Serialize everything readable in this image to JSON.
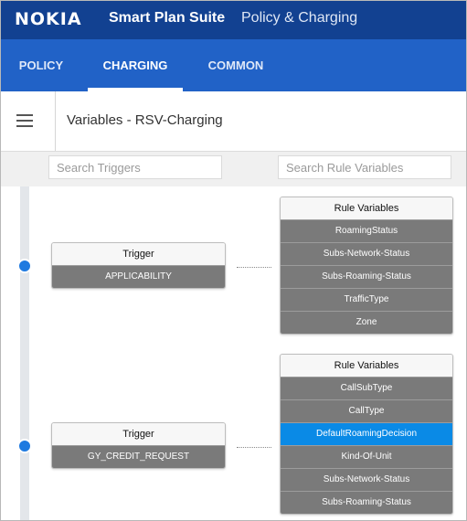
{
  "header": {
    "logo": "NOKIA",
    "app_title": "Smart Plan Suite",
    "app_subtitle": "Policy & Charging"
  },
  "nav": {
    "tabs": [
      {
        "label": "POLICY",
        "active": false
      },
      {
        "label": "CHARGING",
        "active": true
      },
      {
        "label": "COMMON",
        "active": false
      }
    ]
  },
  "title_bar": {
    "title": "Variables - RSV-Charging"
  },
  "search": {
    "triggers_placeholder": "Search Triggers",
    "rule_variables_placeholder": "Search Rule Variables"
  },
  "groups": [
    {
      "trigger_header": "Trigger",
      "trigger_name": "APPLICABILITY",
      "variables_header": "Rule Variables",
      "variables": [
        "RoamingStatus",
        "Subs-Network-Status",
        "Subs-Roaming-Status",
        "TrafficType",
        "Zone"
      ]
    },
    {
      "trigger_header": "Trigger",
      "trigger_name": "GY_CREDIT_REQUEST",
      "variables_header": "Rule Variables",
      "variables": [
        "CallSubType",
        "CallType",
        "DefaultRoamingDecision",
        "Kind-Of-Unit",
        "Subs-Network-Status",
        "Subs-Roaming-Status"
      ],
      "selected_variable": "DefaultRoamingDecision"
    }
  ],
  "colors": {
    "header_bg": "#124191",
    "nav_bg": "#2162c7",
    "selected_row": "#0a8ae6",
    "row_bg": "#7a7a7a",
    "timeline_dot": "#1f7ae0"
  }
}
